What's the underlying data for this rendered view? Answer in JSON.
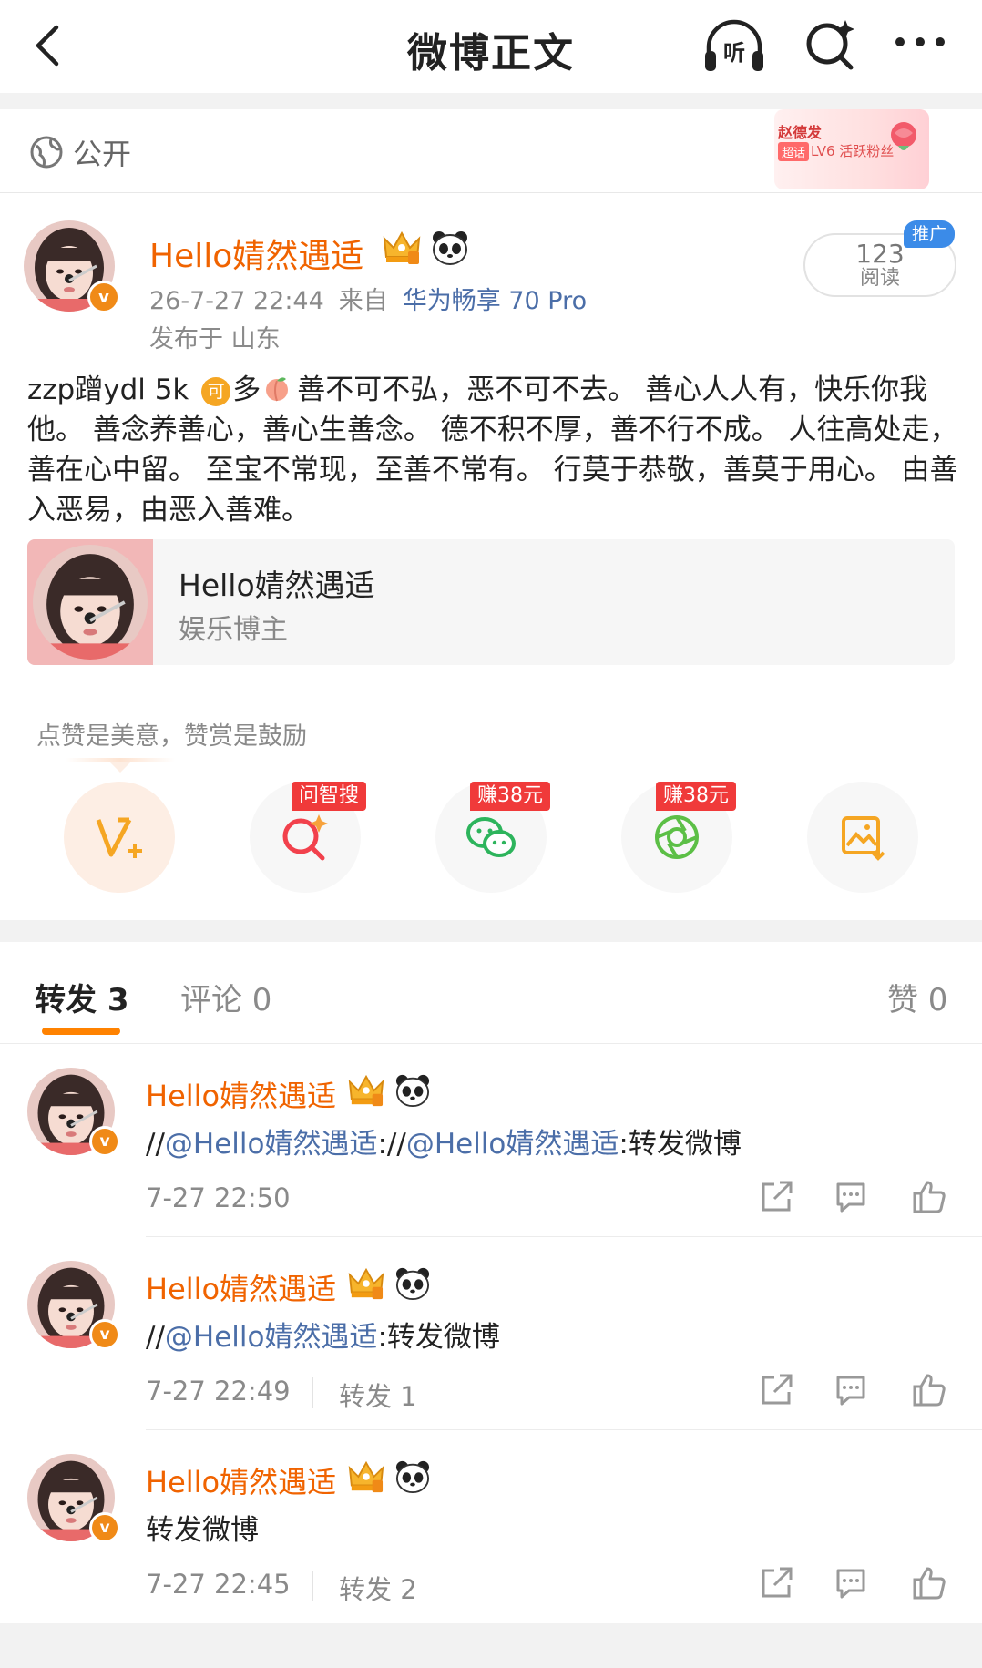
{
  "header": {
    "title": "微博正文"
  },
  "visibility": {
    "label": "公开",
    "fan_badge": {
      "name": "赵德发",
      "tag": "超话",
      "level": "LV6 活跃粉丝"
    }
  },
  "author": {
    "name": "Hello婧然遇适",
    "time": "26-7-27 22:44",
    "source_prefix": "来自",
    "device": "华为畅享 70 Pro",
    "location": "发布于 山东",
    "verified_badge": "v",
    "reads": {
      "count": "123",
      "label": "阅读"
    },
    "promo_tag": "推广"
  },
  "post": {
    "prefix": "zzp蹭ydl 5k",
    "coin_glyph": "可",
    "duo": "多",
    "text": "善不可不弘，恶不可不去。 善心人人有，快乐你我他。 善念养善心，善心生善念。 德不积不厚，善不行不成。 人往高处走，善在心中留。 至宝不常现，至善不常有。 行莫于恭敬，善莫于用心。 由善入恶易，由恶入善难。"
  },
  "profile_card": {
    "name": "Hello婧然遇适",
    "desc": "娱乐博主"
  },
  "reward": {
    "tip": "点赞是美意，赞赏是鼓励",
    "actions": [
      {
        "icon": "v-plus-icon",
        "label": ""
      },
      {
        "icon": "ai-search-icon",
        "label": "问智搜"
      },
      {
        "icon": "wechat-icon",
        "label": "赚38元"
      },
      {
        "icon": "moments-icon",
        "label": "赚38元"
      },
      {
        "icon": "save-image-icon",
        "label": ""
      }
    ]
  },
  "tabs": {
    "forward": "转发 3",
    "comment": "评论 0",
    "like": "赞 0"
  },
  "reposts": [
    {
      "name": "Hello婧然遇适",
      "text_parts": [
        "//",
        "@Hello婧然遇适",
        "://",
        "@Hello婧然遇适",
        ":转发微博"
      ],
      "time": "7-27 22:50",
      "forward_count": ""
    },
    {
      "name": "Hello婧然遇适",
      "text_parts": [
        "//",
        "@Hello婧然遇适",
        ":转发微博",
        "",
        ""
      ],
      "time": "7-27 22:49",
      "forward_count": "转发 1"
    },
    {
      "name": "Hello婧然遇适",
      "text_parts": [
        "转发微博",
        "",
        "",
        "",
        ""
      ],
      "time": "7-27 22:45",
      "forward_count": "转发 2"
    }
  ],
  "colors": {
    "accent_orange": "#f06300",
    "link_blue": "#4b6ea8",
    "tab_underline": "#ff8200",
    "label_red": "#f03a3a"
  }
}
